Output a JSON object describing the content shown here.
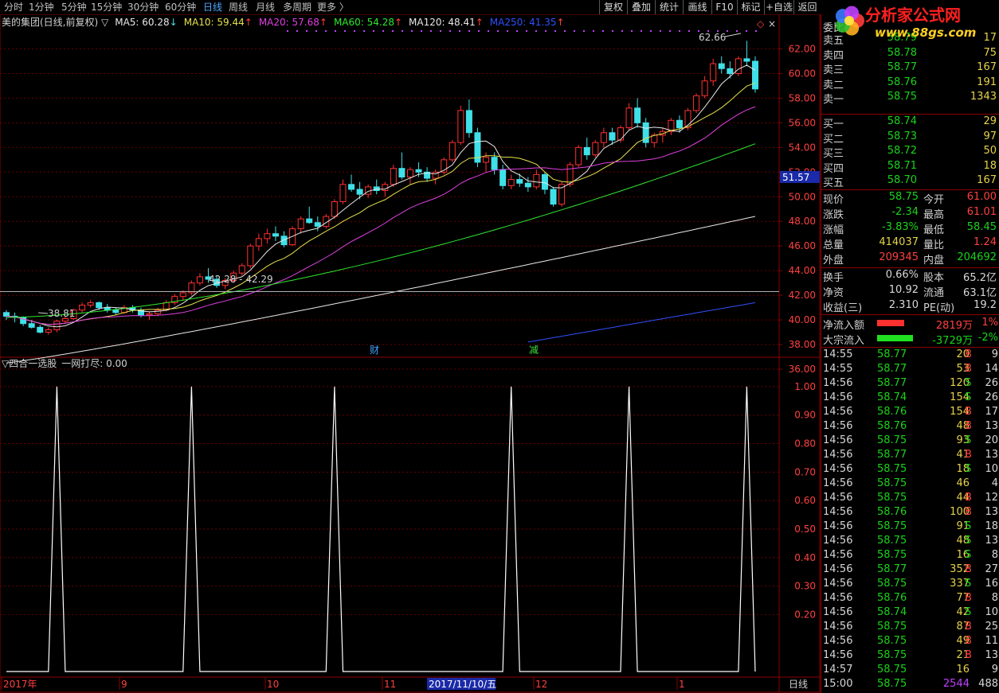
{
  "toolbar": {
    "periods": [
      "分时",
      "1分钟",
      "5分钟",
      "15分钟",
      "30分钟",
      "60分钟",
      "日线",
      "周线",
      "月线",
      "多周期",
      "更多 〉"
    ],
    "active_period": "日线",
    "right_buttons": [
      "复权",
      "叠加",
      "统计",
      "画线",
      "F10",
      "标记",
      "+自选",
      "返回"
    ]
  },
  "logo": {
    "title": "分析家公式网",
    "url": "www.88gs.com"
  },
  "main_header": {
    "title": "美的集团(日线,前复权)",
    "indicators": [
      {
        "label": "MA5: 60.28",
        "arrow": "↓",
        "color": "#e8e8e8"
      },
      {
        "label": "MA10: 59.44",
        "arrow": "↑",
        "color": "#e6e24a"
      },
      {
        "label": "MA20: 57.68",
        "arrow": "↑",
        "color": "#e040e0"
      },
      {
        "label": "MA60: 54.28",
        "arrow": "↑",
        "color": "#2ee82e"
      },
      {
        "label": "MA120: 48.41",
        "arrow": "↑",
        "color": "#e8e8e8"
      },
      {
        "label": "MA250: 41.35",
        "arrow": "↑",
        "color": "#3050ff"
      }
    ]
  },
  "sub_header": {
    "title": "▽四合一选股",
    "value": "一网打尽: 0.00"
  },
  "annotations": {
    "high": "62.66",
    "low": "38.81",
    "range": "42.28 - 42.29",
    "current_price_tag": "51.57",
    "event1": "财",
    "event2": "减",
    "date_cursor": "2017/11/10/五",
    "period_label": "日线"
  },
  "colors": {
    "up": "#ff3030",
    "down": "#40e0e8",
    "grid": "#8b0000",
    "ma5": "#e8e8e8",
    "ma10": "#e6e24a",
    "ma20": "#e040e0",
    "ma60": "#2ee82e",
    "ma120": "#e8e8e8",
    "ma250": "#3050ff"
  },
  "chart_data": [
    {
      "type": "candlestick",
      "title": "美的集团(日线,前复权)",
      "ylim": [
        36,
        63
      ],
      "y_ticks": [
        "62.00",
        "60.00",
        "58.00",
        "56.00",
        "54.00",
        "52.00",
        "50.00",
        "48.00",
        "46.00",
        "44.00",
        "42.00",
        "40.00",
        "38.00",
        "36.00"
      ],
      "x_ticks": [
        "2017年",
        "9",
        "10",
        "11",
        "2017/11/10/五",
        "12",
        "1"
      ],
      "high_marker": 62.66,
      "low_marker": 38.81,
      "ohlc": [
        [
          40.6,
          40.8,
          40.0,
          40.3
        ],
        [
          40.3,
          40.6,
          39.8,
          40.2
        ],
        [
          40.2,
          40.3,
          39.5,
          39.7
        ],
        [
          39.7,
          40.0,
          39.3,
          39.4
        ],
        [
          39.4,
          39.6,
          38.9,
          39.0
        ],
        [
          39.0,
          39.4,
          38.81,
          39.2
        ],
        [
          39.2,
          40.0,
          39.0,
          39.9
        ],
        [
          39.9,
          40.3,
          39.7,
          40.1
        ],
        [
          40.1,
          40.9,
          40.0,
          40.8
        ],
        [
          40.8,
          41.4,
          40.6,
          41.2
        ],
        [
          41.2,
          41.6,
          41.0,
          41.4
        ],
        [
          41.4,
          41.5,
          40.8,
          41.0
        ],
        [
          41.0,
          41.3,
          40.6,
          40.8
        ],
        [
          40.8,
          41.0,
          40.4,
          40.6
        ],
        [
          40.6,
          41.2,
          40.5,
          41.0
        ],
        [
          41.0,
          41.2,
          40.6,
          40.8
        ],
        [
          40.8,
          41.0,
          40.2,
          40.4
        ],
        [
          40.4,
          40.7,
          40.0,
          40.5
        ],
        [
          40.5,
          41.0,
          40.3,
          40.8
        ],
        [
          40.8,
          41.6,
          40.7,
          41.4
        ],
        [
          41.4,
          42.1,
          41.2,
          41.9
        ],
        [
          41.9,
          42.4,
          41.6,
          42.2
        ],
        [
          42.2,
          43.2,
          42.0,
          43.0
        ],
        [
          43.0,
          43.8,
          42.8,
          43.5
        ],
        [
          43.5,
          44.2,
          43.0,
          43.3
        ],
        [
          43.3,
          43.6,
          42.6,
          42.8
        ],
        [
          42.8,
          43.4,
          42.5,
          43.2
        ],
        [
          43.2,
          44.0,
          43.0,
          43.8
        ],
        [
          43.8,
          44.6,
          43.6,
          44.4
        ],
        [
          44.4,
          46.2,
          44.2,
          46.0
        ],
        [
          46.0,
          47.0,
          45.6,
          46.6
        ],
        [
          46.6,
          47.4,
          46.2,
          47.0
        ],
        [
          47.0,
          47.6,
          46.4,
          46.8
        ],
        [
          46.8,
          47.2,
          45.9,
          46.1
        ],
        [
          46.1,
          47.6,
          46.0,
          47.4
        ],
        [
          47.4,
          48.4,
          47.0,
          48.2
        ],
        [
          48.2,
          49.2,
          47.8,
          47.9
        ],
        [
          47.9,
          48.4,
          47.2,
          47.6
        ],
        [
          47.6,
          48.6,
          47.4,
          48.4
        ],
        [
          48.4,
          49.8,
          48.2,
          49.6
        ],
        [
          49.6,
          51.4,
          49.4,
          51.0
        ],
        [
          51.0,
          51.8,
          50.4,
          50.6
        ],
        [
          50.6,
          51.2,
          49.8,
          50.2
        ],
        [
          50.2,
          51.0,
          49.9,
          50.8
        ],
        [
          50.8,
          51.4,
          50.2,
          50.5
        ],
        [
          50.5,
          51.2,
          50.0,
          51.0
        ],
        [
          51.0,
          52.6,
          50.8,
          52.3
        ],
        [
          52.3,
          53.6,
          51.4,
          51.6
        ],
        [
          51.6,
          52.4,
          51.0,
          52.2
        ],
        [
          52.2,
          52.8,
          51.6,
          52.0
        ],
        [
          52.0,
          52.4,
          51.2,
          51.5
        ],
        [
          51.5,
          52.2,
          51.0,
          52.0
        ],
        [
          52.0,
          53.2,
          51.8,
          53.0
        ],
        [
          53.0,
          54.6,
          52.8,
          54.4
        ],
        [
          54.4,
          57.4,
          54.2,
          57.0
        ],
        [
          57.0,
          57.9,
          54.8,
          55.2
        ],
        [
          55.2,
          55.6,
          52.4,
          52.8
        ],
        [
          52.8,
          53.6,
          52.0,
          53.2
        ],
        [
          53.2,
          53.6,
          51.8,
          52.2
        ],
        [
          52.2,
          52.6,
          50.6,
          50.9
        ],
        [
          50.9,
          51.8,
          50.6,
          51.4
        ],
        [
          51.4,
          51.9,
          50.8,
          51.1
        ],
        [
          51.1,
          51.6,
          50.4,
          50.8
        ],
        [
          50.8,
          52.2,
          50.6,
          51.8
        ],
        [
          51.8,
          52.0,
          50.2,
          50.6
        ],
        [
          50.6,
          50.8,
          49.2,
          49.4
        ],
        [
          49.4,
          51.2,
          49.2,
          51.0
        ],
        [
          51.0,
          52.8,
          50.8,
          52.6
        ],
        [
          52.6,
          54.2,
          52.4,
          54.0
        ],
        [
          54.0,
          54.8,
          53.0,
          53.4
        ],
        [
          53.4,
          54.6,
          53.2,
          54.4
        ],
        [
          54.4,
          55.6,
          54.0,
          55.2
        ],
        [
          55.2,
          55.6,
          54.2,
          54.6
        ],
        [
          54.6,
          55.8,
          54.4,
          55.6
        ],
        [
          55.6,
          57.6,
          55.4,
          57.2
        ],
        [
          57.2,
          58.0,
          55.6,
          56.0
        ],
        [
          56.0,
          56.4,
          54.0,
          54.4
        ],
        [
          54.4,
          55.2,
          54.0,
          55.0
        ],
        [
          55.0,
          55.6,
          54.4,
          55.3
        ],
        [
          55.3,
          56.4,
          55.0,
          56.2
        ],
        [
          56.2,
          56.6,
          55.2,
          55.6
        ],
        [
          55.6,
          57.2,
          55.4,
          57.0
        ],
        [
          57.0,
          58.4,
          56.8,
          58.2
        ],
        [
          58.2,
          59.8,
          58.0,
          59.4
        ],
        [
          59.4,
          61.2,
          59.0,
          60.8
        ],
        [
          60.8,
          61.4,
          60.0,
          60.4
        ],
        [
          60.4,
          61.0,
          59.6,
          60.0
        ],
        [
          60.0,
          61.4,
          59.8,
          61.2
        ],
        [
          61.2,
          62.66,
          60.6,
          61.0
        ],
        [
          61.0,
          61.4,
          58.45,
          58.75
        ]
      ]
    },
    {
      "type": "line",
      "title": "四合一选股",
      "ylim": [
        0,
        1.05
      ],
      "y_ticks": [
        "1.00",
        "0.90",
        "0.80",
        "0.70",
        "0.60",
        "0.50",
        "0.40",
        "0.30",
        "0.20"
      ],
      "signal_positions": [
        6,
        22,
        39,
        60,
        74,
        88,
        90
      ]
    }
  ],
  "quote_panel": {
    "order_book_title": "委比",
    "asks": [
      {
        "label": "卖五",
        "price": "58.79",
        "vol": "17"
      },
      {
        "label": "卖四",
        "price": "58.78",
        "vol": "75"
      },
      {
        "label": "卖三",
        "price": "58.77",
        "vol": "167"
      },
      {
        "label": "卖二",
        "price": "58.76",
        "vol": "191"
      },
      {
        "label": "卖一",
        "price": "58.75",
        "vol": "1343"
      }
    ],
    "bids": [
      {
        "label": "买一",
        "price": "58.74",
        "vol": "29"
      },
      {
        "label": "买二",
        "price": "58.73",
        "vol": "97"
      },
      {
        "label": "买三",
        "price": "58.72",
        "vol": "50"
      },
      {
        "label": "买四",
        "price": "58.71",
        "vol": "18"
      },
      {
        "label": "买五",
        "price": "58.70",
        "vol": "167"
      }
    ],
    "stats": [
      {
        "l1": "现价",
        "v1": "58.75",
        "c1": "green",
        "l2": "今开",
        "v2": "61.00",
        "c2": "red"
      },
      {
        "l1": "涨跌",
        "v1": "-2.34",
        "c1": "green",
        "l2": "最高",
        "v2": "61.01",
        "c2": "red"
      },
      {
        "l1": "涨幅",
        "v1": "-3.83%",
        "c1": "green",
        "l2": "最低",
        "v2": "58.45",
        "c2": "green"
      },
      {
        "l1": "总量",
        "v1": "414037",
        "c1": "yellow",
        "l2": "量比",
        "v2": "1.24",
        "c2": "red"
      },
      {
        "l1": "外盘",
        "v1": "209345",
        "c1": "red",
        "l2": "内盘",
        "v2": "204692",
        "c2": "green"
      }
    ],
    "fundamentals": [
      {
        "l1": "换手",
        "v1": "0.66%",
        "l2": "股本",
        "v2": "65.2亿"
      },
      {
        "l1": "净资",
        "v1": "10.92",
        "l2": "流通",
        "v2": "63.1亿"
      },
      {
        "l1": "收益(三)",
        "v1": "2.310",
        "l2": "PE(动)",
        "v2": "19.2"
      }
    ],
    "flows": [
      {
        "label": "净流入额",
        "value": "2819万",
        "pct": "1%",
        "color": "red",
        "bar": 0.6
      },
      {
        "label": "大宗流入",
        "value": "-3729万",
        "pct": "-2%",
        "color": "green",
        "bar": 0.8
      }
    ],
    "ticks": [
      {
        "t": "14:55",
        "p": "58.77",
        "v": "20",
        "s": "B",
        "n": "9"
      },
      {
        "t": "14:55",
        "p": "58.77",
        "v": "53",
        "s": "B",
        "n": "14"
      },
      {
        "t": "14:56",
        "p": "58.77",
        "v": "120",
        "s": "S",
        "n": "26"
      },
      {
        "t": "14:56",
        "p": "58.74",
        "v": "154",
        "s": "S",
        "n": "26"
      },
      {
        "t": "14:56",
        "p": "58.76",
        "v": "154",
        "s": "B",
        "n": "17"
      },
      {
        "t": "14:56",
        "p": "58.76",
        "v": "48",
        "s": "B",
        "n": "13"
      },
      {
        "t": "14:56",
        "p": "58.75",
        "v": "93",
        "s": "S",
        "n": "20"
      },
      {
        "t": "14:56",
        "p": "58.77",
        "v": "41",
        "s": "B",
        "n": "13"
      },
      {
        "t": "14:56",
        "p": "58.75",
        "v": "18",
        "s": "S",
        "n": "10"
      },
      {
        "t": "14:56",
        "p": "58.75",
        "v": "46",
        "s": "",
        "n": "4"
      },
      {
        "t": "14:56",
        "p": "58.75",
        "v": "44",
        "s": "B",
        "n": "12"
      },
      {
        "t": "14:56",
        "p": "58.76",
        "v": "100",
        "s": "B",
        "n": "13"
      },
      {
        "t": "14:56",
        "p": "58.75",
        "v": "91",
        "s": "S",
        "n": "18"
      },
      {
        "t": "14:56",
        "p": "58.75",
        "v": "48",
        "s": "S",
        "n": "13"
      },
      {
        "t": "14:56",
        "p": "58.75",
        "v": "16",
        "s": "S",
        "n": "8"
      },
      {
        "t": "14:56",
        "p": "58.77",
        "v": "352",
        "s": "B",
        "n": "27"
      },
      {
        "t": "14:56",
        "p": "58.75",
        "v": "337",
        "s": "S",
        "n": "16"
      },
      {
        "t": "14:56",
        "p": "58.76",
        "v": "77",
        "s": "B",
        "n": "8"
      },
      {
        "t": "14:56",
        "p": "58.74",
        "v": "42",
        "s": "S",
        "n": "10"
      },
      {
        "t": "14:56",
        "p": "58.75",
        "v": "87",
        "s": "B",
        "n": "25"
      },
      {
        "t": "14:56",
        "p": "58.75",
        "v": "49",
        "s": "B",
        "n": "11"
      },
      {
        "t": "14:56",
        "p": "58.75",
        "v": "21",
        "s": "B",
        "n": "13"
      },
      {
        "t": "14:57",
        "p": "58.75",
        "v": "16",
        "s": "",
        "n": "9"
      },
      {
        "t": "15:00",
        "p": "58.75",
        "v": "2544",
        "s": "",
        "n": "488"
      }
    ]
  }
}
